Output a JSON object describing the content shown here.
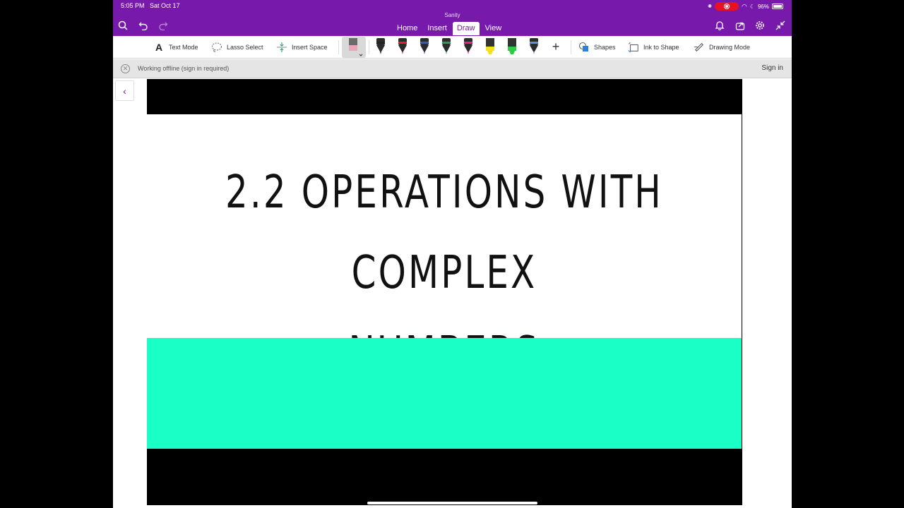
{
  "status_bar": {
    "time": "5:05 PM",
    "date": "Sat Oct 17",
    "battery": "96%"
  },
  "app": {
    "title": "Sanity"
  },
  "tabs": [
    {
      "label": "Home",
      "active": false
    },
    {
      "label": "Insert",
      "active": false
    },
    {
      "label": "Draw",
      "active": true
    },
    {
      "label": "View",
      "active": false
    }
  ],
  "ribbon": {
    "text_mode": "Text Mode",
    "lasso_select": "Lasso Select",
    "insert_space": "Insert Space",
    "shapes": "Shapes",
    "ink_to_shape": "Ink to Shape",
    "drawing_mode": "Drawing Mode",
    "pens": [
      {
        "name": "black-pen",
        "color": "#222222"
      },
      {
        "name": "red-pen",
        "color": "#d9233b"
      },
      {
        "name": "blue-pen",
        "color": "#2c5fb5"
      },
      {
        "name": "green-pen",
        "color": "#2f9a4b"
      },
      {
        "name": "magenta-pen",
        "color": "#e2257e"
      },
      {
        "name": "yellow-highlighter",
        "color": "#f5e11a"
      },
      {
        "name": "green-highlighter",
        "color": "#2ecc40"
      },
      {
        "name": "galaxy-pen",
        "color": "#6a8bd6"
      }
    ]
  },
  "offline_bar": {
    "message": "Working offline (sign in required)",
    "sign_in": "Sign in"
  },
  "slide": {
    "title_line1": "2.2 OPERATIONS WITH COMPLEX",
    "title_line2": "NUMBERS",
    "accent_color": "#1affc6"
  }
}
